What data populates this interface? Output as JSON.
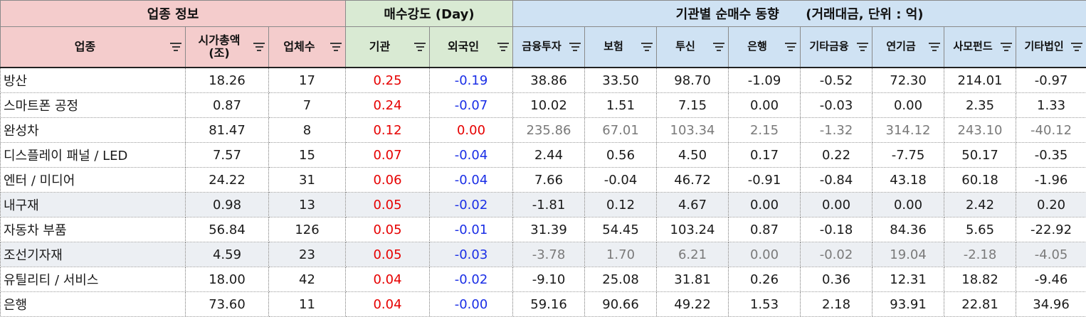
{
  "group_headers": {
    "info": "업종 정보",
    "strength": "매수강도 (Day)",
    "institutional": "기관별 순매수 동향      (거래대금, 단위 : 억)"
  },
  "columns": {
    "sector": "업종",
    "market_cap": "시가총액\n(조)",
    "companies": "업체수",
    "inst": "기관",
    "foreign": "외국인",
    "finance": "금융투자",
    "insurance": "보험",
    "trust": "투신",
    "bank": "은행",
    "other_finance": "기타금융",
    "pension": "연기금",
    "private_fund": "사모펀드",
    "other_corp": "기타법인"
  },
  "colors": {
    "info_header_bg": "#f4cccc",
    "strength_header_bg": "#d9ead3",
    "inst_header_bg": "#cfe2f3",
    "positive": "#e60000",
    "negative": "#1a2ee6",
    "dim_text": "#7a7a7a",
    "shaded_row": "#eceff3"
  },
  "icons": {
    "filter": "filter-icon"
  },
  "rows": [
    {
      "sector": "방산",
      "market_cap": "18.26",
      "companies": "17",
      "inst": "0.25",
      "foreign": "-0.19",
      "finance": "38.86",
      "insurance": "33.50",
      "trust": "98.70",
      "bank": "-1.09",
      "other_finance": "-0.52",
      "pension": "72.30",
      "private_fund": "214.01",
      "other_corp": "-0.97"
    },
    {
      "sector": "스마트폰 공정",
      "market_cap": "0.87",
      "companies": "7",
      "inst": "0.24",
      "foreign": "-0.07",
      "finance": "10.02",
      "insurance": "1.51",
      "trust": "7.15",
      "bank": "0.00",
      "other_finance": "-0.03",
      "pension": "0.00",
      "private_fund": "2.35",
      "other_corp": "1.33"
    },
    {
      "sector": "완성차",
      "market_cap": "81.47",
      "companies": "8",
      "inst": "0.12",
      "foreign": "0.00",
      "finance": "235.86",
      "insurance": "67.01",
      "trust": "103.34",
      "bank": "2.15",
      "other_finance": "-1.32",
      "pension": "314.12",
      "private_fund": "243.10",
      "other_corp": "-40.12"
    },
    {
      "sector": "디스플레이 패널 / LED",
      "market_cap": "7.57",
      "companies": "15",
      "inst": "0.07",
      "foreign": "-0.04",
      "finance": "2.44",
      "insurance": "0.56",
      "trust": "4.50",
      "bank": "0.17",
      "other_finance": "0.22",
      "pension": "-7.75",
      "private_fund": "50.17",
      "other_corp": "-0.35"
    },
    {
      "sector": "엔터 / 미디어",
      "market_cap": "24.22",
      "companies": "31",
      "inst": "0.06",
      "foreign": "-0.04",
      "finance": "7.66",
      "insurance": "-0.04",
      "trust": "46.72",
      "bank": "-0.91",
      "other_finance": "-0.84",
      "pension": "43.18",
      "private_fund": "60.18",
      "other_corp": "-1.96"
    },
    {
      "sector": "내구재",
      "market_cap": "0.98",
      "companies": "13",
      "inst": "0.05",
      "foreign": "-0.02",
      "finance": "-1.81",
      "insurance": "0.12",
      "trust": "4.67",
      "bank": "0.00",
      "other_finance": "0.00",
      "pension": "0.00",
      "private_fund": "2.42",
      "other_corp": "0.20"
    },
    {
      "sector": "자동차 부품",
      "market_cap": "56.84",
      "companies": "126",
      "inst": "0.05",
      "foreign": "-0.01",
      "finance": "31.39",
      "insurance": "54.45",
      "trust": "103.24",
      "bank": "0.87",
      "other_finance": "-0.18",
      "pension": "84.36",
      "private_fund": "5.65",
      "other_corp": "-22.92"
    },
    {
      "sector": "조선기자재",
      "market_cap": "4.59",
      "companies": "23",
      "inst": "0.05",
      "foreign": "-0.03",
      "finance": "-3.78",
      "insurance": "1.70",
      "trust": "6.21",
      "bank": "0.00",
      "other_finance": "-0.02",
      "pension": "19.04",
      "private_fund": "-2.18",
      "other_corp": "-4.05"
    },
    {
      "sector": "유틸리티 / 서비스",
      "market_cap": "18.00",
      "companies": "42",
      "inst": "0.04",
      "foreign": "-0.02",
      "finance": "-9.10",
      "insurance": "25.08",
      "trust": "31.81",
      "bank": "0.26",
      "other_finance": "0.36",
      "pension": "12.31",
      "private_fund": "18.82",
      "other_corp": "-9.46"
    },
    {
      "sector": "은행",
      "market_cap": "73.60",
      "companies": "11",
      "inst": "0.04",
      "foreign": "-0.00",
      "finance": "59.16",
      "insurance": "90.66",
      "trust": "49.22",
      "bank": "1.53",
      "other_finance": "2.18",
      "pension": "93.91",
      "private_fund": "22.81",
      "other_corp": "34.96"
    }
  ]
}
